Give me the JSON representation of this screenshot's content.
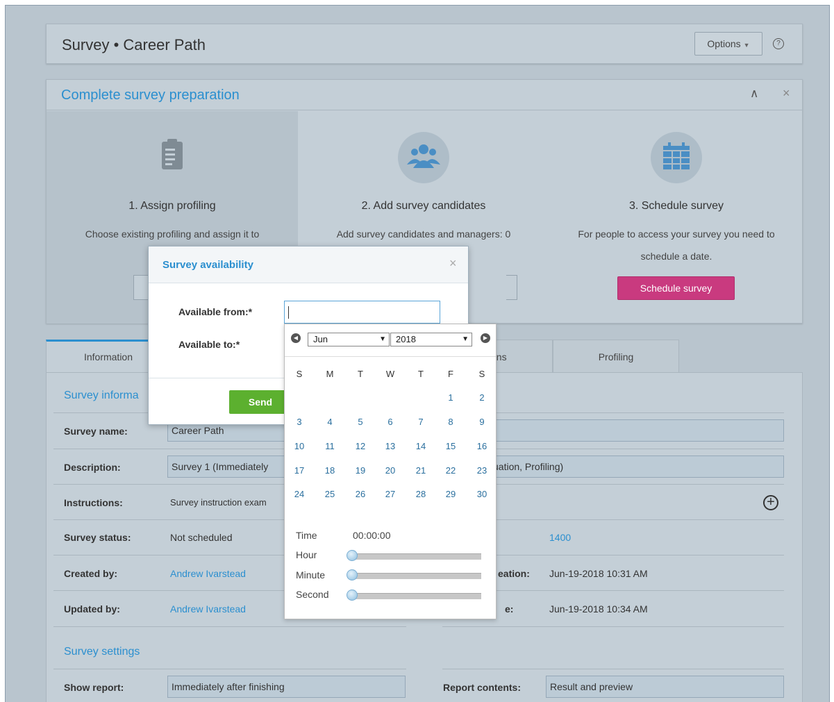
{
  "header": {
    "title": "Survey • Career Path",
    "options_label": "Options",
    "help_icon": "?"
  },
  "prep": {
    "title": "Complete survey preparation",
    "steps": [
      {
        "title": "1. Assign profiling",
        "desc": "Choose existing profiling and assign it to",
        "icon": "clipboard-icon"
      },
      {
        "title": "2. Add survey candidates",
        "desc": "Add survey candidates and managers: 0",
        "icon": "people-icon"
      },
      {
        "title": "3. Schedule survey",
        "desc": "For people to access your survey you need to schedule a date.",
        "button": "Schedule survey",
        "icon": "calendar-icon"
      }
    ]
  },
  "tabs": [
    {
      "label": "Information",
      "active": true
    },
    {
      "label": "ons"
    },
    {
      "label": "Profiling"
    }
  ],
  "info": {
    "section_title": "Survey informa",
    "survey_name_label": "Survey name:",
    "survey_name_value": "Career Path",
    "description_label": "Description:",
    "description_value": "Survey 1 (Immediately",
    "description_value_tail": "uation, Profiling)",
    "instructions_label": "Instructions:",
    "instructions_value": "Survey instruction exam",
    "status_label": "Survey status:",
    "status_value": "Not scheduled",
    "id_value": "1400",
    "created_by_label": "Created by:",
    "created_by_value": "Andrew Ivarstead",
    "creation_label_tail": "eation:",
    "creation_value": "Jun-19-2018 10:31 AM",
    "updated_by_label": "Updated by:",
    "updated_by_value": "Andrew Ivarstead",
    "update_label_tail": "e:",
    "update_value": "Jun-19-2018 10:34 AM"
  },
  "settings": {
    "section_title": "Survey settings",
    "show_report_label": "Show report:",
    "show_report_value": "Immediately after finishing",
    "report_contents_label": "Report contents:",
    "report_contents_value": "Result and preview"
  },
  "modal": {
    "title": "Survey availability",
    "from_label": "Available from:*",
    "to_label": "Available to:*",
    "from_value": "",
    "send_label": "Send"
  },
  "datepicker": {
    "month": "Jun",
    "year": "2018",
    "weekdays": [
      "S",
      "M",
      "T",
      "W",
      "T",
      "F",
      "S"
    ],
    "weeks": [
      [
        "",
        "",
        "",
        "",
        "",
        "1",
        "2"
      ],
      [
        "3",
        "4",
        "5",
        "6",
        "7",
        "8",
        "9"
      ],
      [
        "10",
        "11",
        "12",
        "13",
        "14",
        "15",
        "16"
      ],
      [
        "17",
        "18",
        "19",
        "20",
        "21",
        "22",
        "23"
      ],
      [
        "24",
        "25",
        "26",
        "27",
        "28",
        "29",
        "30"
      ]
    ],
    "time_label": "Time",
    "time_value": "00:00:00",
    "hour_label": "Hour",
    "minute_label": "Minute",
    "second_label": "Second",
    "hour_fraction": 0,
    "minute_fraction": 0,
    "second_fraction": 0
  },
  "colors": {
    "accent": "#2b8fcf",
    "schedule_button": "#c93a7f",
    "send_button": "#5cb02f"
  }
}
